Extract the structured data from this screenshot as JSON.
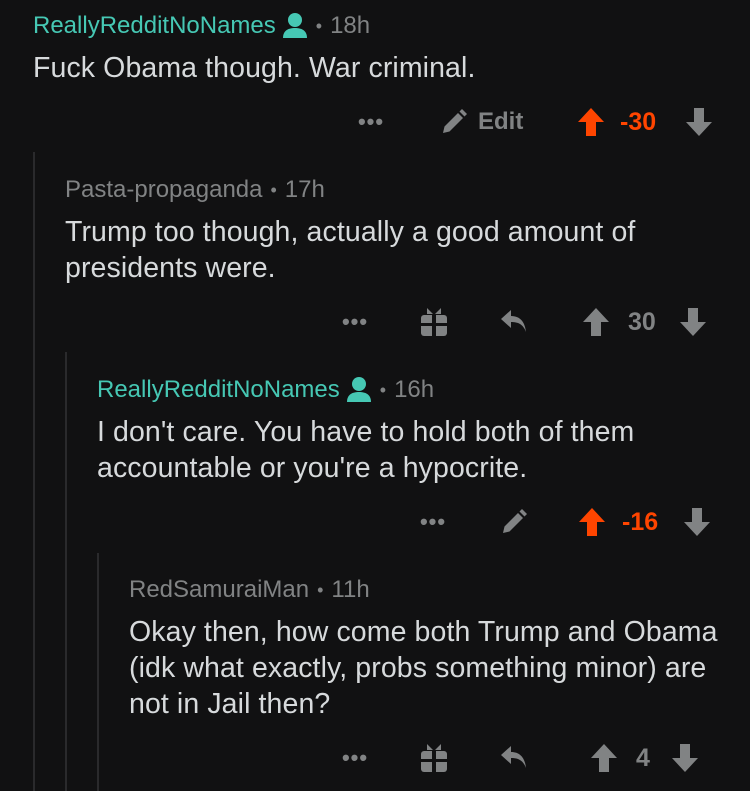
{
  "comments": [
    {
      "author": "ReallyRedditNoNames",
      "is_op": true,
      "age": "18h",
      "body": "Fuck Obama though. War criminal.",
      "actions": {
        "more": "•••",
        "edit_label": "Edit",
        "score": "-30",
        "upvoted": true
      }
    },
    {
      "author": "Pasta-propaganda",
      "is_op": false,
      "age": "17h",
      "body": "Trump too though, actually a good amount of presidents were.",
      "actions": {
        "more": "•••",
        "score": "30",
        "upvoted": false
      }
    },
    {
      "author": "ReallyRedditNoNames",
      "is_op": true,
      "age": "16h",
      "body": "I don't care. You have to hold both of them accountable or you're a hypocrite.",
      "actions": {
        "more": "•••",
        "score": "-16",
        "upvoted": true
      }
    },
    {
      "author": "RedSamuraiMan",
      "is_op": false,
      "age": "11h",
      "body": "Okay then, how come both Trump and Obama (idk what exactly, probs something minor) are not in Jail then?",
      "actions": {
        "more": "•••",
        "score": "4",
        "upvoted": false
      }
    }
  ],
  "meta_separator": "•",
  "colors": {
    "background": "#111112",
    "op_author": "#46c8b4",
    "muted": "#818384",
    "upvote": "#ff4500",
    "text": "#d7dadc"
  }
}
